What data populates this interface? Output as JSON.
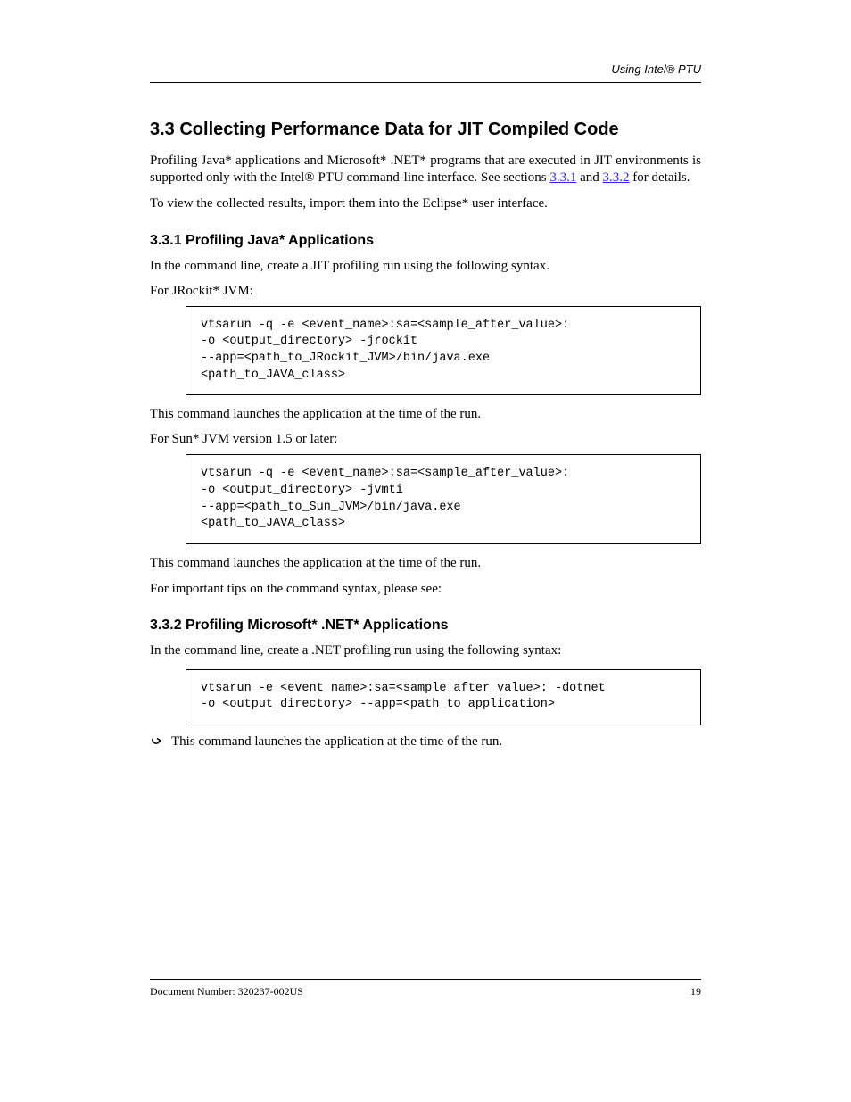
{
  "header": {
    "right": "Using Intel® PTU"
  },
  "section": {
    "heading": "3.3  Collecting Performance Data for JIT Compiled Code",
    "para1_part1": "Profiling Java* applications and Microsoft* .NET* programs that are executed in JIT environments is supported only with the Intel® PTU command-line interface. See sections ",
    "link1": "3.3.1",
    "para1_mid": " and ",
    "link2": "3.3.2",
    "para1_part2": " for details.",
    "para2": "To view the collected results, import them into the Eclipse* user interface."
  },
  "subsection1": {
    "heading": "3.3.1  Profiling Java* Applications",
    "intro": "In the command line, create a JIT profiling run using the following syntax.",
    "box1_label": "For JRockit* JVM:",
    "box1_code": [
      "vtsarun -q -e <event_name>:sa=<sample_after_value>:",
      "-o <output_directory> -jrockit",
      "--app=<path_to_JRockit_JVM>/bin/java.exe",
      "<path_to_JAVA_class>"
    ],
    "between12": "This command launches the application at the time of the run.",
    "box2_label": "For Sun* JVM version 1.5 or later:",
    "box2_code": [
      "vtsarun -q -e <event_name>:sa=<sample_after_value>:",
      "-o <output_directory> -jvmti",
      "--app=<path_to_Sun_JVM>/bin/java.exe",
      "<path_to_JAVA_class>"
    ],
    "under2_line1": "This command launches the application at the time of the run.",
    "under2_line2": "For important tips on the command syntax, please see:"
  },
  "subsection2": {
    "heading": "3.3.2  Profiling Microsoft* .NET* Applications",
    "intro": "In the command line, create a .NET profiling run using the following syntax:",
    "box3_code": [
      "vtsarun -e <event_name>:sa=<sample_after_value>: -dotnet",
      "-o <output_directory> --app=<path_to_application>"
    ],
    "note": "This command launches the application at the time of the run."
  },
  "footer": {
    "left": "Document Number: 320237-002US",
    "right": "19"
  }
}
